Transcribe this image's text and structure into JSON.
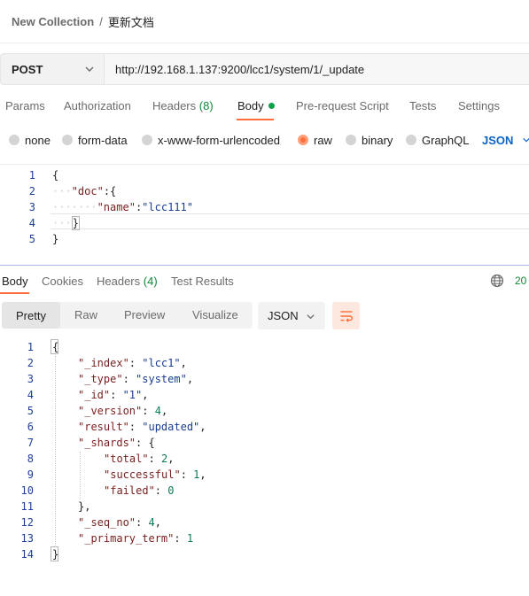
{
  "breadcrumb": {
    "parent": "New Collection",
    "separator": "/",
    "current": "更新文档"
  },
  "request": {
    "method": "POST",
    "url": "http://192.168.1.137:9200/lcc1/system/1/_update"
  },
  "request_tabs": [
    {
      "label": "Params"
    },
    {
      "label": "Authorization"
    },
    {
      "label": "Headers",
      "count": "(8)"
    },
    {
      "label": "Body",
      "active": true
    },
    {
      "label": "Pre-request Script"
    },
    {
      "label": "Tests"
    },
    {
      "label": "Settings"
    }
  ],
  "body_types": [
    {
      "label": "none",
      "selected": false
    },
    {
      "label": "form-data",
      "selected": false
    },
    {
      "label": "x-www-form-urlencoded",
      "selected": false
    },
    {
      "label": "raw",
      "selected": true
    },
    {
      "label": "binary",
      "selected": false
    },
    {
      "label": "GraphQL",
      "selected": false
    }
  ],
  "raw_language": "JSON",
  "request_body_lines": [
    {
      "num": "1",
      "text": "{"
    },
    {
      "num": "2",
      "key": "\"doc\"",
      "rest": ":{"
    },
    {
      "num": "3",
      "key": "\"name\"",
      "sep": ":",
      "value": "\"lcc111\""
    },
    {
      "num": "4",
      "text": "}"
    },
    {
      "num": "5",
      "text": "}"
    }
  ],
  "response_tabs": [
    {
      "label": "Body",
      "active": true
    },
    {
      "label": "Cookies"
    },
    {
      "label": "Headers",
      "count": "(4)"
    },
    {
      "label": "Test Results"
    }
  ],
  "response_status_partial": "20",
  "view_modes": [
    "Pretty",
    "Raw",
    "Preview",
    "Visualize"
  ],
  "response_format": "JSON",
  "response_body_lines": [
    {
      "num": "1",
      "text": "{"
    },
    {
      "num": "2",
      "key": "\"_index\"",
      "value": "\"lcc1\"",
      "tail": ","
    },
    {
      "num": "3",
      "key": "\"_type\"",
      "value": "\"system\"",
      "tail": ","
    },
    {
      "num": "4",
      "key": "\"_id\"",
      "value": "\"1\"",
      "tail": ","
    },
    {
      "num": "5",
      "key": "\"_version\"",
      "value": "4",
      "tail": ","
    },
    {
      "num": "6",
      "key": "\"result\"",
      "value": "\"updated\"",
      "tail": ","
    },
    {
      "num": "7",
      "key": "\"_shards\"",
      "value": "{",
      "tail": ""
    },
    {
      "num": "8",
      "key": "\"total\"",
      "value": "2",
      "tail": ","
    },
    {
      "num": "9",
      "key": "\"successful\"",
      "value": "1",
      "tail": ","
    },
    {
      "num": "10",
      "key": "\"failed\"",
      "value": "0",
      "tail": ""
    },
    {
      "num": "11",
      "text": "},"
    },
    {
      "num": "12",
      "key": "\"_seq_no\"",
      "value": "4",
      "tail": ","
    },
    {
      "num": "13",
      "key": "\"_primary_term\"",
      "value": "1",
      "tail": ""
    },
    {
      "num": "14",
      "text": "}"
    }
  ],
  "icons": {
    "globe": "globe-icon",
    "wrap": "wrap-lines-icon",
    "chevron": "chevron-down-icon"
  },
  "colors": {
    "accent": "#ff6c37",
    "json_key": "#7a1f1f",
    "json_value": "#1a3d8f",
    "line_number": "#1e3f99",
    "count": "#0f8a3a"
  }
}
